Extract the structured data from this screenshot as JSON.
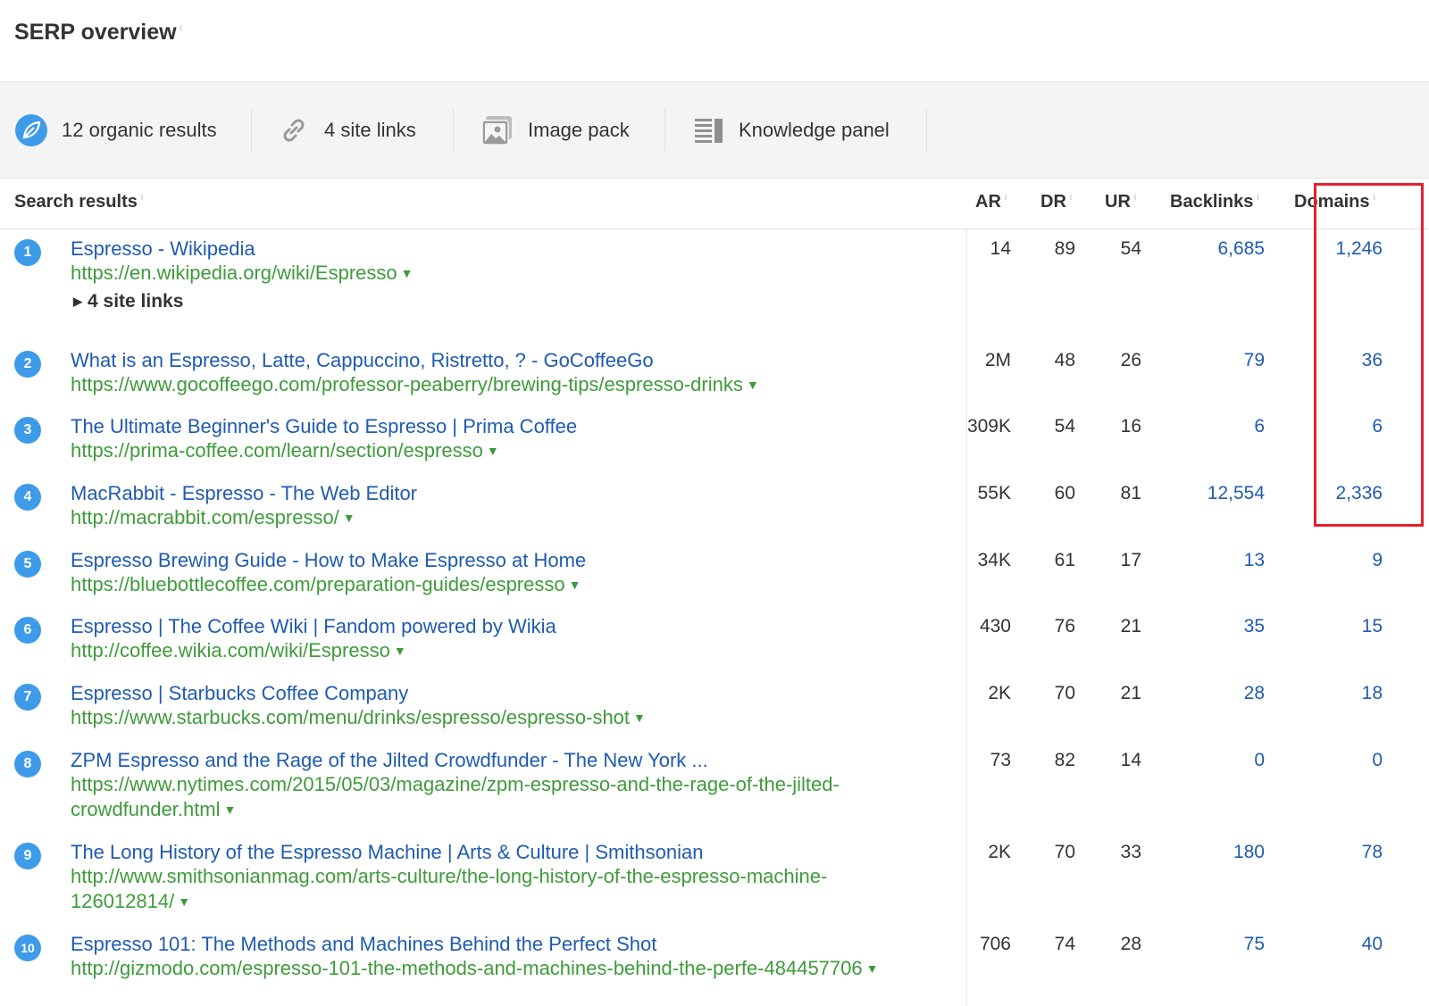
{
  "header": {
    "title": "SERP overview",
    "info": "i"
  },
  "features": [
    {
      "label": "12 organic results",
      "icon": "leaf-icon"
    },
    {
      "label": "4 site links",
      "icon": "link-icon"
    },
    {
      "label": "Image pack",
      "icon": "image-icon"
    },
    {
      "label": "Knowledge panel",
      "icon": "knowledge-panel-icon"
    }
  ],
  "table": {
    "columns": {
      "search_results": "Search results",
      "ar": "AR",
      "dr": "DR",
      "ur": "UR",
      "backlinks": "Backlinks",
      "domains": "Domains"
    },
    "info": "i",
    "rows": [
      {
        "rank": "1",
        "title": "Espresso - Wikipedia",
        "url": "https://en.wikipedia.org/wiki/Espresso",
        "sitelinks": "4 site links",
        "ar": "14",
        "dr": "89",
        "ur": "54",
        "backlinks": "6,685",
        "domains": "1,246"
      },
      {
        "rank": "2",
        "title": "What is an Espresso, Latte, Cappuccino, Ristretto, ? - GoCoffeeGo",
        "url": "https://www.gocoffeego.com/professor-peaberry/brewing-tips/espresso-drinks",
        "ar": "2M",
        "dr": "48",
        "ur": "26",
        "backlinks": "79",
        "domains": "36"
      },
      {
        "rank": "3",
        "title": "The Ultimate Beginner's Guide to Espresso | Prima Coffee",
        "url": "https://prima-coffee.com/learn/section/espresso",
        "ar": "309K",
        "dr": "54",
        "ur": "16",
        "backlinks": "6",
        "domains": "6"
      },
      {
        "rank": "4",
        "title": "MacRabbit - Espresso - The Web Editor",
        "url": "http://macrabbit.com/espresso/",
        "ar": "55K",
        "dr": "60",
        "ur": "81",
        "backlinks": "12,554",
        "domains": "2,336"
      },
      {
        "rank": "5",
        "title": "Espresso Brewing Guide - How to Make Espresso at Home",
        "url": "https://bluebottlecoffee.com/preparation-guides/espresso",
        "ar": "34K",
        "dr": "61",
        "ur": "17",
        "backlinks": "13",
        "domains": "9"
      },
      {
        "rank": "6",
        "title": "Espresso | The Coffee Wiki | Fandom powered by Wikia",
        "url": "http://coffee.wikia.com/wiki/Espresso",
        "ar": "430",
        "dr": "76",
        "ur": "21",
        "backlinks": "35",
        "domains": "15"
      },
      {
        "rank": "7",
        "title": "Espresso | Starbucks Coffee Company",
        "url": "https://www.starbucks.com/menu/drinks/espresso/espresso-shot",
        "ar": "2K",
        "dr": "70",
        "ur": "21",
        "backlinks": "28",
        "domains": "18"
      },
      {
        "rank": "8",
        "title": "ZPM Espresso and the Rage of the Jilted Crowdfunder - The New York ...",
        "url_line1": "https://www.nytimes.com/2015/05/03/magazine/zpm-espresso-and-the-rage-of-the-jilted-",
        "url_line2": "crowdfunder.html",
        "ar": "73",
        "dr": "82",
        "ur": "14",
        "backlinks": "0",
        "domains": "0"
      },
      {
        "rank": "9",
        "title": "The Long History of the Espresso Machine | Arts & Culture | Smithsonian",
        "url_line1": "http://www.smithsonianmag.com/arts-culture/the-long-history-of-the-espresso-machine-",
        "url_line2": "126012814/",
        "ar": "2K",
        "dr": "70",
        "ur": "33",
        "backlinks": "180",
        "domains": "78"
      },
      {
        "rank": "10",
        "title": "Espresso 101: The Methods and Machines Behind the Perfect Shot",
        "url": "http://gizmodo.com/espresso-101-the-methods-and-machines-behind-the-perfe-484457706",
        "ar": "706",
        "dr": "74",
        "ur": "28",
        "backlinks": "75",
        "domains": "40"
      }
    ]
  },
  "colors": {
    "link": "#1f5bb0",
    "url": "#3e9b3a",
    "badge": "#3d9be9",
    "highlight": "#e5202e",
    "toolbar_bg": "#f4f4f4"
  }
}
